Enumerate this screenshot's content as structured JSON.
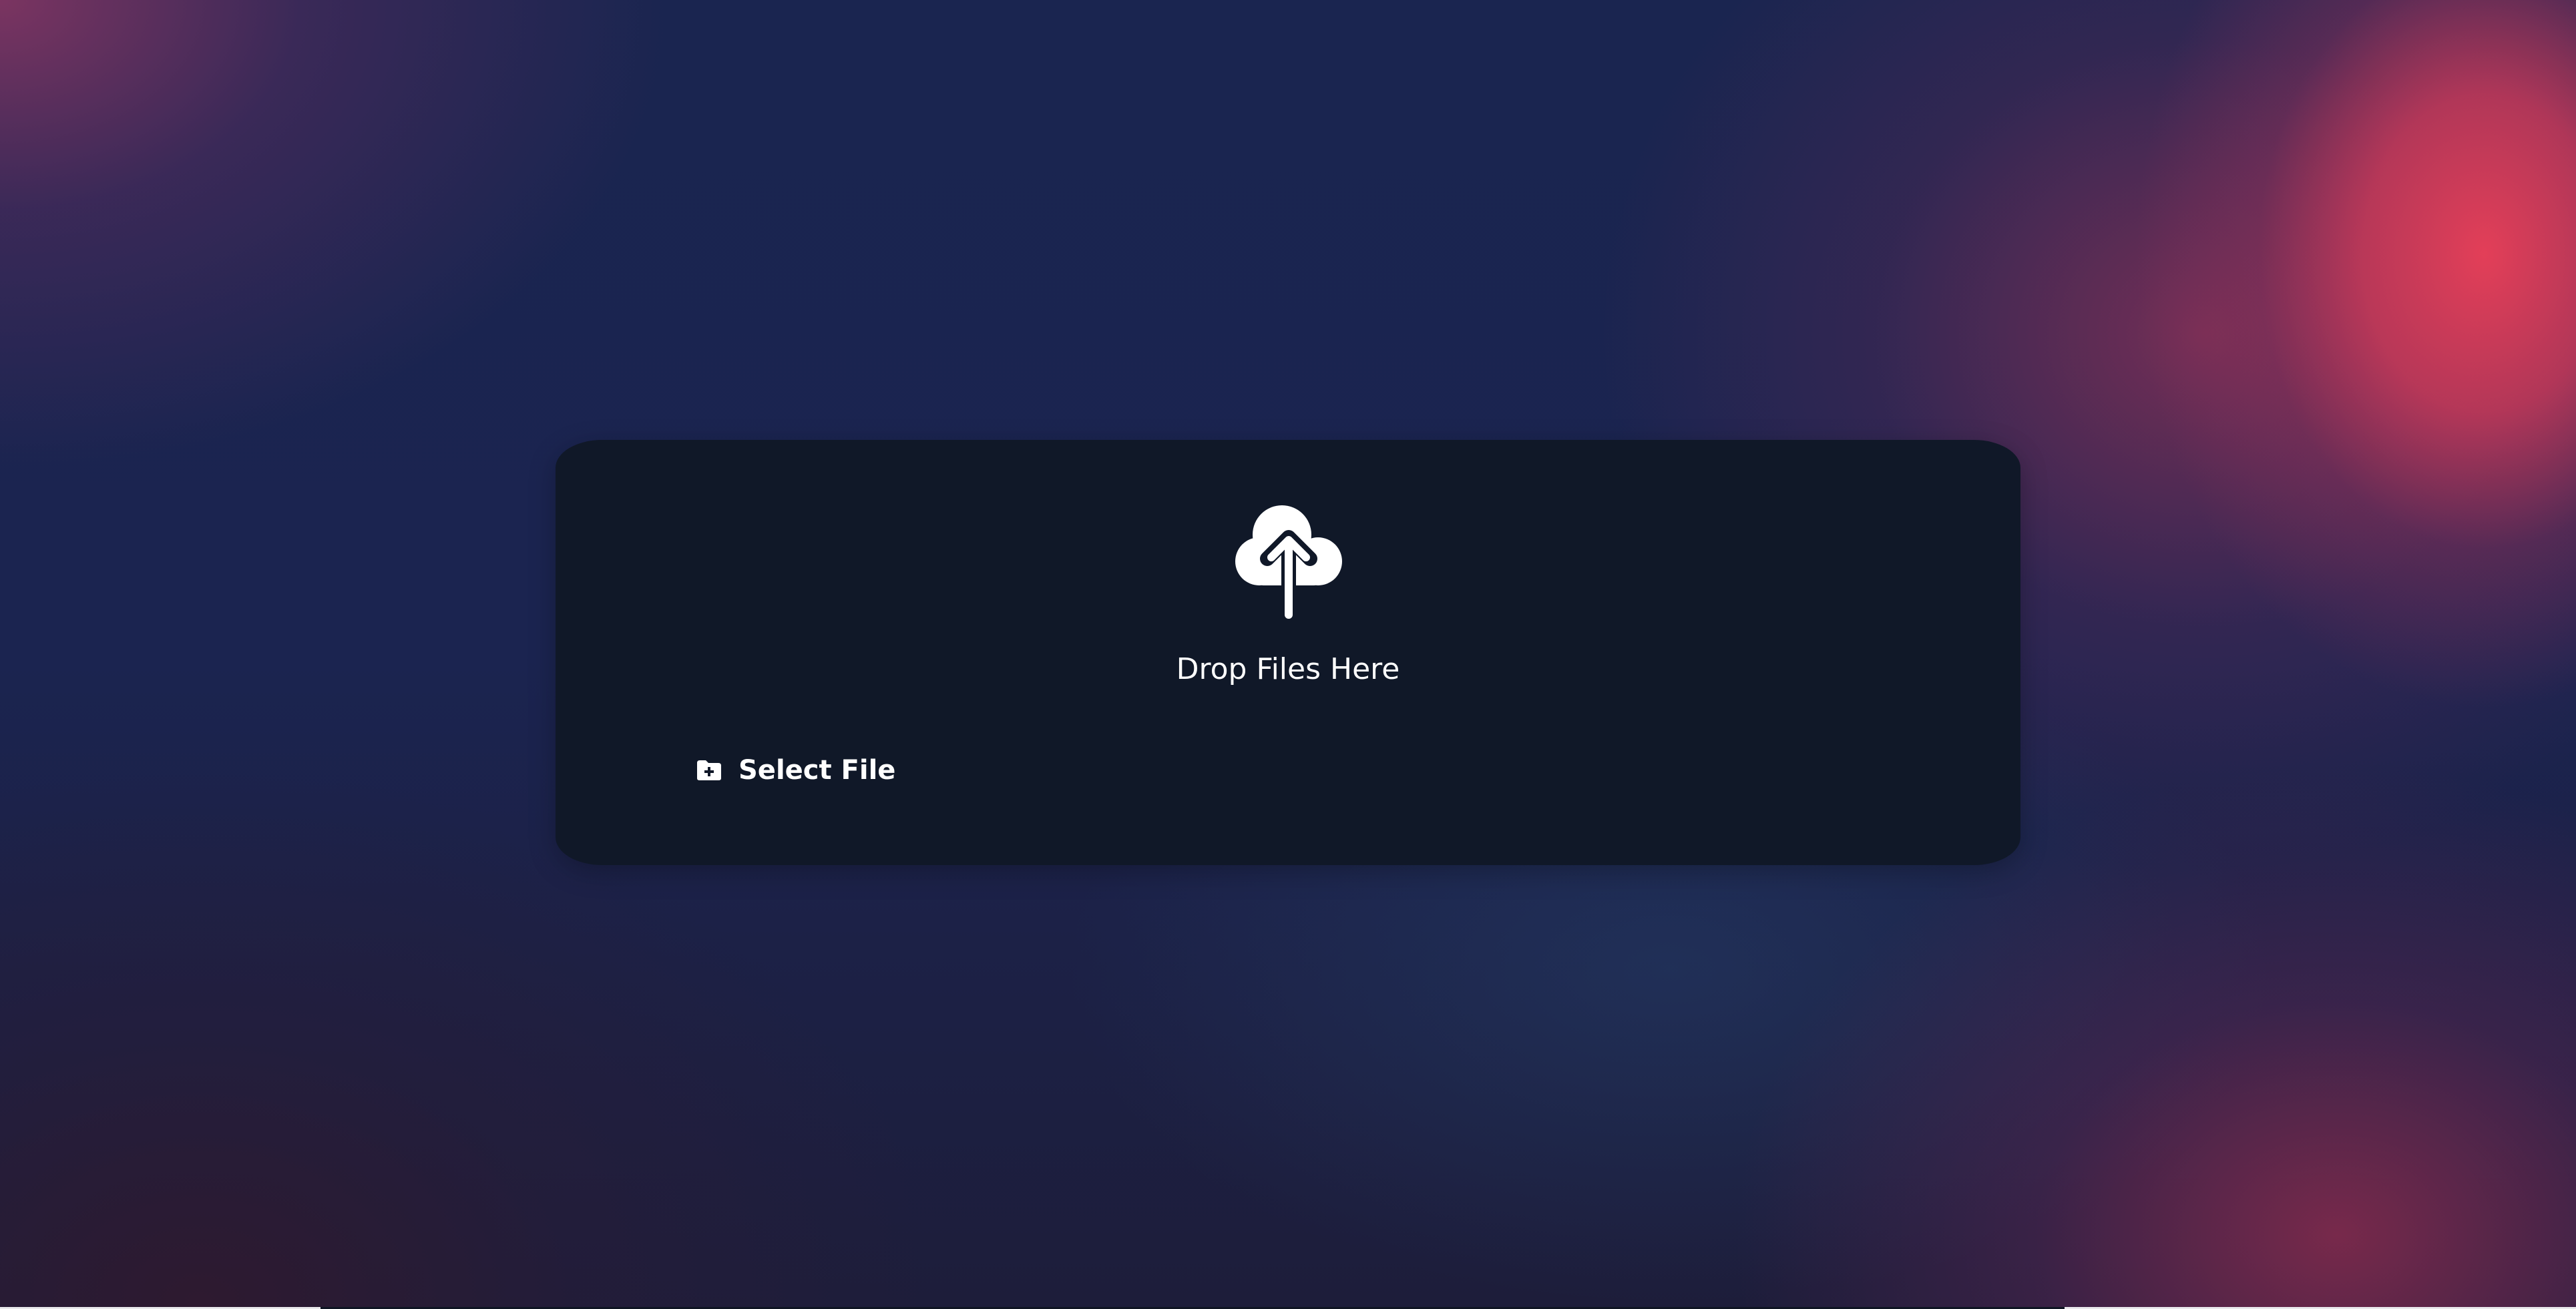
{
  "dropzone": {
    "title": "Drop Files Here",
    "icon": "cloud-upload-icon"
  },
  "select_button": {
    "label": "Select File",
    "icon": "folder-plus-icon"
  },
  "colors": {
    "panel_background": "#101828",
    "text": "#ffffff",
    "accent_glow": "#e94058"
  }
}
